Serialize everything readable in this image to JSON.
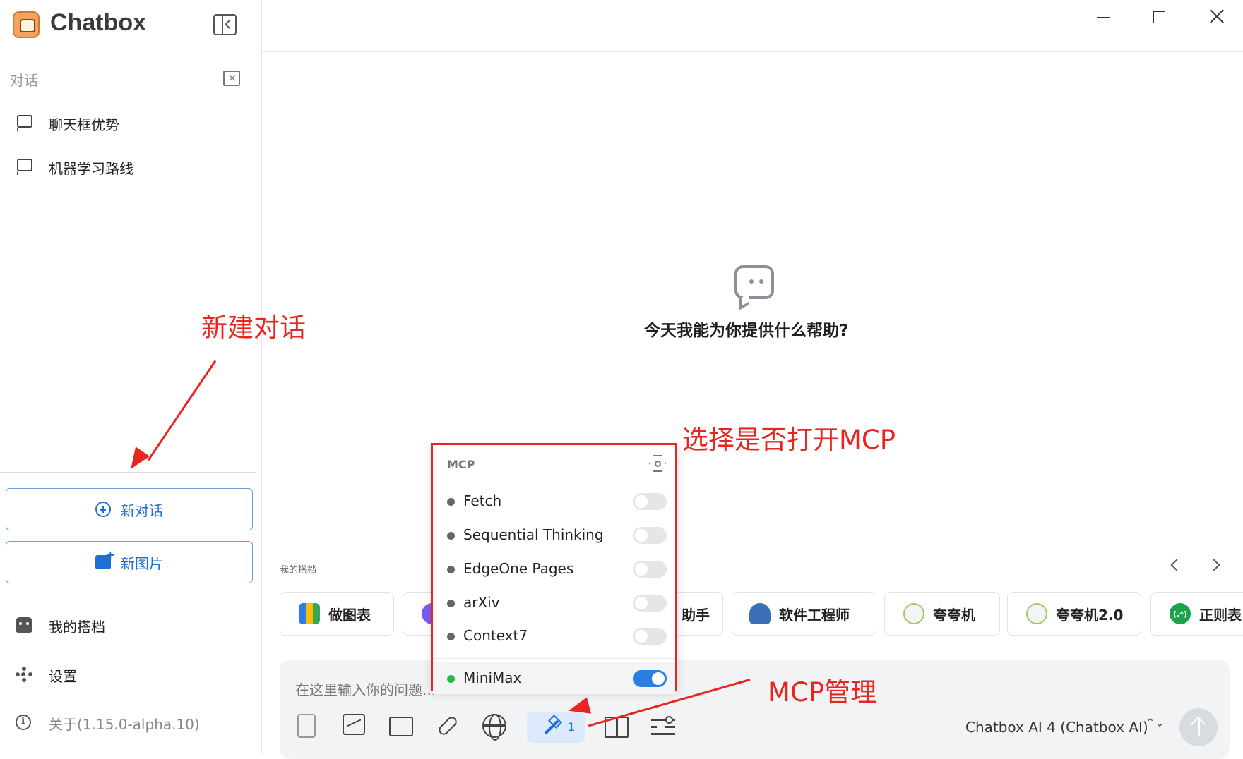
{
  "app": {
    "title": "Chatbox"
  },
  "sidebar": {
    "section_label": "对话",
    "conversations": [
      {
        "label": "聊天框优势"
      },
      {
        "label": "机器学习路线"
      }
    ],
    "new_chat_label": "新对话",
    "new_image_label": "新图片",
    "menu": [
      {
        "label": "我的搭档",
        "icon": "robot-icon"
      },
      {
        "label": "设置",
        "icon": "gear-icon"
      },
      {
        "label": "关于(1.15.0-alpha.10)",
        "icon": "info-icon"
      }
    ]
  },
  "main": {
    "welcome": "今天我能为你提供什么帮助?",
    "partners_label": "我的搭档",
    "partners": [
      {
        "label": "做图表",
        "icon": "bar-chart-icon",
        "color": "#2b7de9"
      },
      {
        "label": "",
        "icon": "purple-circle-icon",
        "color": "#7c5cf0"
      },
      {
        "label": "助手",
        "icon": "assistant-icon",
        "color": "#999999"
      },
      {
        "label": "软件工程师",
        "icon": "engineer-icon",
        "color": "#3b6fb6"
      },
      {
        "label": "夸夸机",
        "icon": "cheer-icon",
        "color": "#9ccc65"
      },
      {
        "label": "夸夸机2.0",
        "icon": "cheer-icon",
        "color": "#9ccc65"
      },
      {
        "label": "正则表",
        "icon": "regex-icon",
        "color": "#1aa34a",
        "glyph": "(.*)"
      }
    ],
    "input_placeholder": "在这里输入你的问题...",
    "mcp_count": "1",
    "model": "Chatbox AI 4 (Chatbox AI)",
    "model_caret": "⌃⌄"
  },
  "mcp_popup": {
    "title": "MCP",
    "servers": [
      {
        "name": "Fetch",
        "enabled": false,
        "status_color": "#666666"
      },
      {
        "name": "Sequential Thinking",
        "enabled": false,
        "status_color": "#666666"
      },
      {
        "name": "EdgeOne Pages",
        "enabled": false,
        "status_color": "#666666"
      },
      {
        "name": "arXiv",
        "enabled": false,
        "status_color": "#666666"
      },
      {
        "name": "Context7",
        "enabled": false,
        "status_color": "#666666"
      },
      {
        "name": "MiniMax",
        "enabled": true,
        "status_color": "#22bb44"
      }
    ]
  },
  "annotations": {
    "new_chat": "新建对话",
    "mcp_toggle": "选择是否打开MCP",
    "mcp_manage": "MCP管理",
    "color": "#e8261f"
  }
}
